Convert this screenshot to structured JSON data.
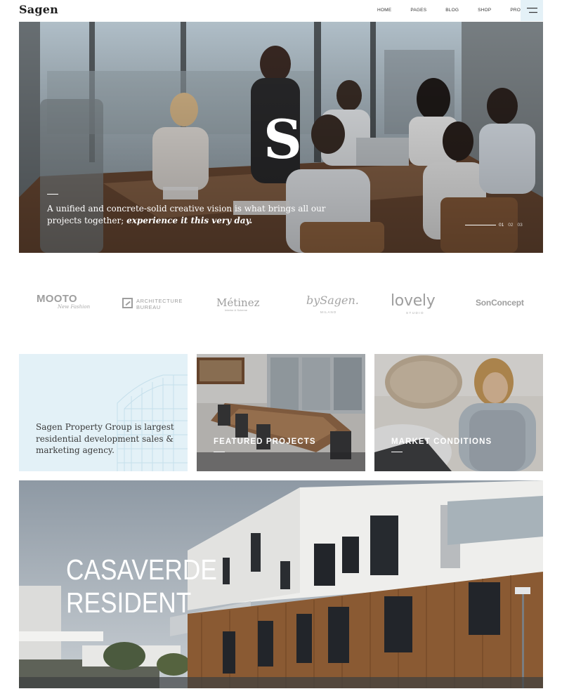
{
  "header": {
    "logo": "Sagen",
    "nav": [
      "HOME",
      "PAGES",
      "BLOG",
      "SHOP",
      "PROPERTY"
    ],
    "menu_icon": "hamburger-icon"
  },
  "hero": {
    "letter": "S",
    "text_plain": "A unified and concrete-solid creative vision is what brings all our projects together; ",
    "text_emphasis": "experience it this very day.",
    "pager": [
      "01",
      "02",
      "03"
    ]
  },
  "clients": {
    "mooto": {
      "name": "MOOTO",
      "sub": "New Fashion"
    },
    "architecture": {
      "line1": "ARCHITECTURE",
      "line2": "BUREAU"
    },
    "metinez": {
      "name": "Métinez",
      "sub": "Interior & Scheme"
    },
    "bysagen": {
      "name": "bySagen.",
      "sub": "MILANO"
    },
    "lovely": {
      "name": "lovely",
      "sub": "STUDIO"
    },
    "sonconcept": {
      "name": "SonConcept"
    }
  },
  "cards": {
    "intro": "Sagen Property Group is largest residential development sales & marketing agency.",
    "projects_label": "FEATURED PROJECTS",
    "market_label": "MARKET CONDITIONS"
  },
  "banner": {
    "line1": "CASAVERDE",
    "line2": "RESIDENT"
  },
  "colors": {
    "accent_light": "#e3f1f7",
    "text_dark": "#222222",
    "logo_grey": "#9e9e9e"
  }
}
